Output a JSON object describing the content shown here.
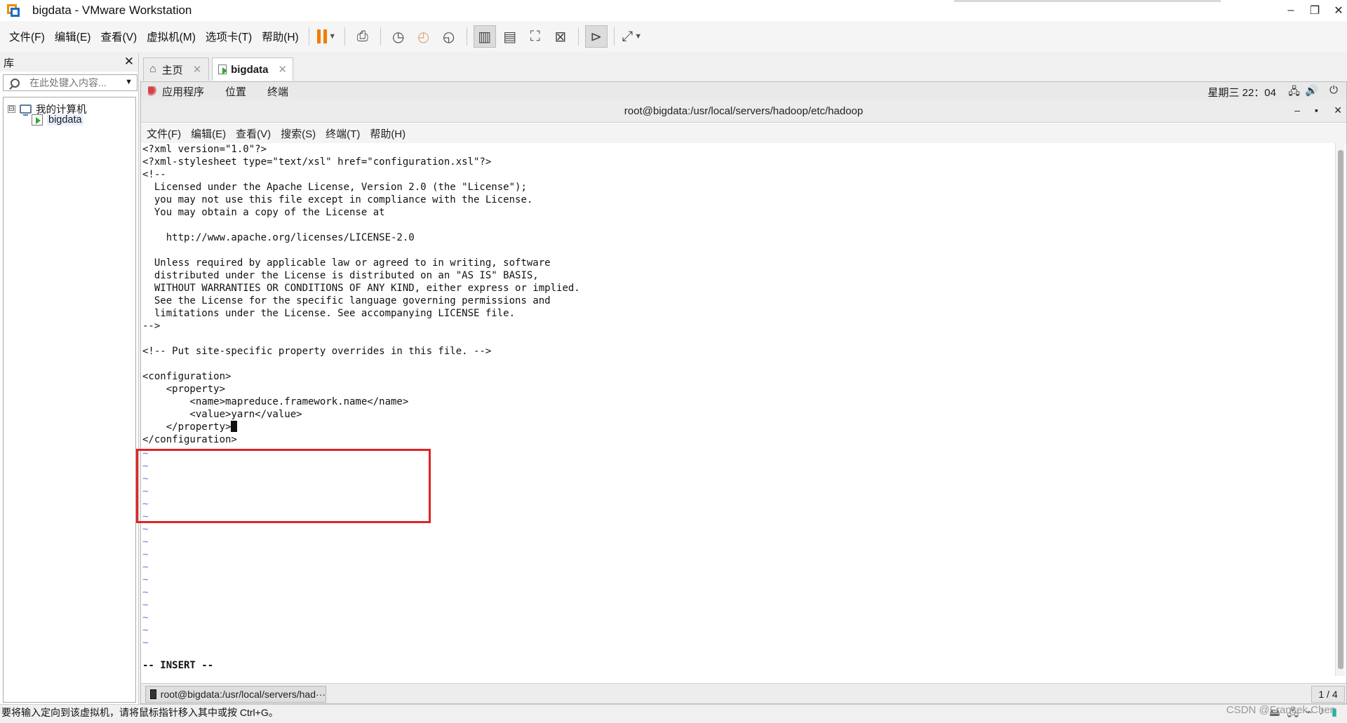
{
  "window": {
    "title": "bigdata - VMware Workstation",
    "minimize": "–",
    "restore": "❐",
    "close": "✕"
  },
  "menubar": {
    "items": [
      "文件(F)",
      "编辑(E)",
      "查看(V)",
      "虚拟机(M)",
      "选项卡(T)",
      "帮助(H)"
    ],
    "pause_color": "#f07d00"
  },
  "library": {
    "title": "库",
    "close": "✕",
    "search_placeholder": "在此处键入内容...",
    "tree": {
      "root_label": "我的计算机",
      "root_expander": "⊟",
      "vm_label": "bigdata"
    }
  },
  "tabs": [
    {
      "label": "主页",
      "close": "✕"
    },
    {
      "label": "bigdata",
      "close": "✕"
    }
  ],
  "gnome": {
    "menu": [
      "应用程序",
      "位置",
      "终端"
    ],
    "clock": "星期三 22：04"
  },
  "terminal": {
    "title": "root@bigdata:/usr/local/servers/hadoop/etc/hadoop",
    "controls": {
      "minimize": "–",
      "maximize": "▪",
      "close": "✕"
    },
    "menu": [
      "文件(F)",
      "编辑(E)",
      "查看(V)",
      "搜索(S)",
      "终端(T)",
      "帮助(H)"
    ],
    "lines": [
      "<?xml version=\"1.0\"?>",
      "<?xml-stylesheet type=\"text/xsl\" href=\"configuration.xsl\"?>",
      "<!--",
      "  Licensed under the Apache License, Version 2.0 (the \"License\");",
      "  you may not use this file except in compliance with the License.",
      "  You may obtain a copy of the License at",
      "",
      "    http://www.apache.org/licenses/LICENSE-2.0",
      "",
      "  Unless required by applicable law or agreed to in writing, software",
      "  distributed under the License is distributed on an \"AS IS\" BASIS,",
      "  WITHOUT WARRANTIES OR CONDITIONS OF ANY KIND, either express or implied.",
      "  See the License for the specific language governing permissions and",
      "  limitations under the License. See accompanying LICENSE file.",
      "-->",
      "",
      "<!-- Put site-specific property overrides in this file. -->",
      "",
      "<configuration>",
      "    <property>",
      "        <name>mapreduce.framework.name</name>",
      "        <value>yarn</value>",
      "    </property>",
      "</configuration>"
    ],
    "tilde": "~",
    "tilde_count": 16,
    "mode": "-- INSERT --",
    "highlight_color": "#e12424"
  },
  "taskbar": {
    "task_label": "root@bigdata:/usr/local/servers/had···",
    "pager": "1 / 4"
  },
  "statusbar": {
    "hint": "要将输入定向到该虚拟机，请将鼠标指针移入其中或按 Ctrl+G。",
    "watermark": "CSDN @Francek Chen"
  }
}
